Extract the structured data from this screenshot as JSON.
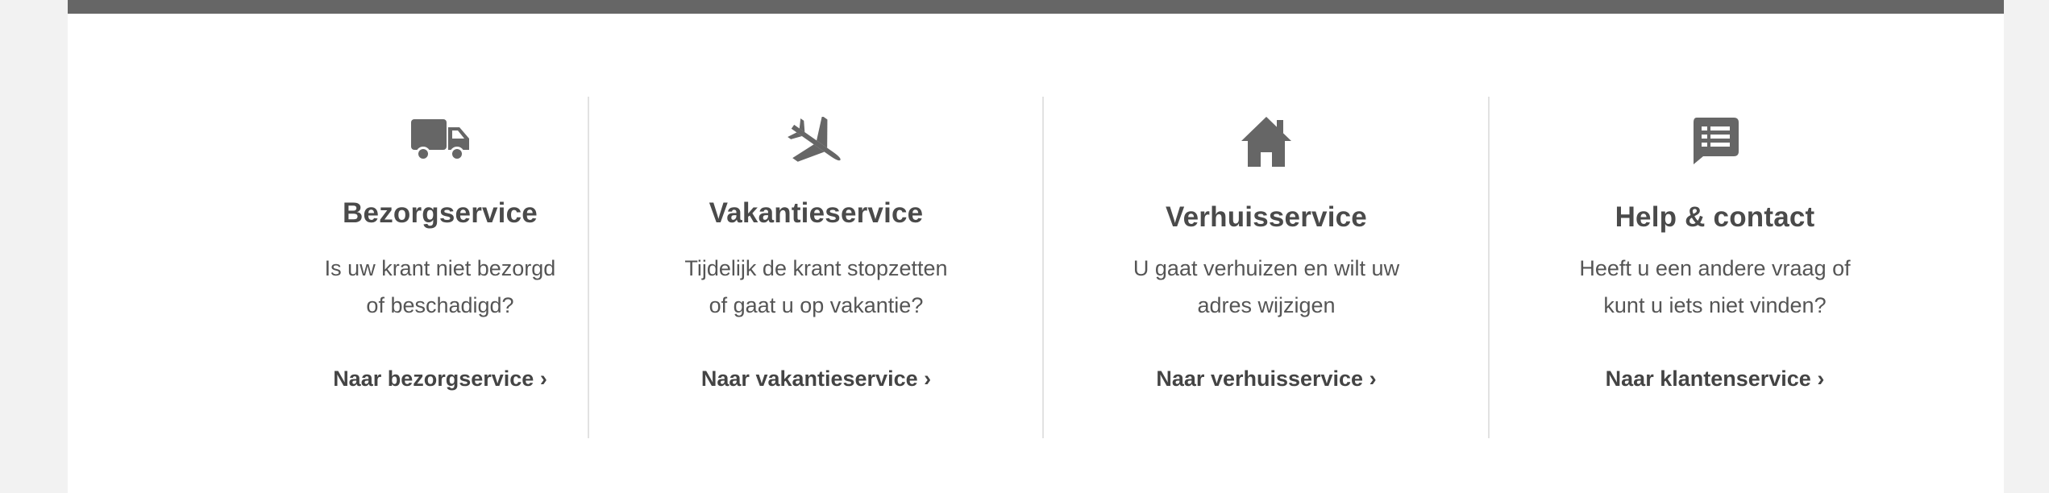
{
  "services": [
    {
      "icon": "truck-icon",
      "title": "Bezorgservice",
      "desc_line1": "Is uw krant niet bezorgd",
      "desc_line2": "of beschadigd?",
      "link": "Naar bezorgservice ›"
    },
    {
      "icon": "airplane-icon",
      "title": "Vakantieservice",
      "desc_line1": "Tijdelijk de krant stopzetten",
      "desc_line2": "of gaat u op vakantie?",
      "link": "Naar vakantieservice ›"
    },
    {
      "icon": "house-icon",
      "title": "Verhuisservice",
      "desc_line1": "U gaat verhuizen en wilt uw",
      "desc_line2": "adres wijzigen",
      "link": "Naar verhuisservice ›"
    },
    {
      "icon": "chat-list-icon",
      "title": "Help & contact",
      "desc_line1": "Heeft u een andere vraag of",
      "desc_line2": "kunt u iets niet vinden?",
      "link": "Naar klantenservice ›"
    }
  ],
  "colors": {
    "page_background": "#f2f2f2",
    "panel_background": "#ffffff",
    "top_bar": "#666666",
    "icon": "#666666",
    "title": "#4a4a4a",
    "text": "#555555",
    "divider": "#e2e2e2"
  }
}
